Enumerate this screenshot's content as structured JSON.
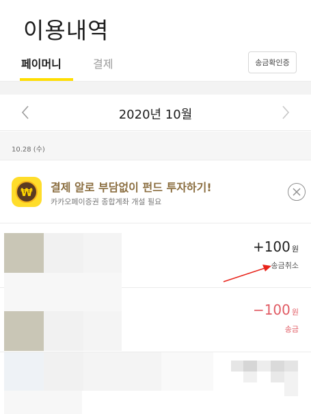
{
  "header": {
    "title": "이용내역",
    "tabs": [
      {
        "label": "페이머니",
        "selected": true
      },
      {
        "label": "결제",
        "selected": false
      }
    ],
    "verify_button": "송금확인증"
  },
  "month_selector": {
    "label": "2020년 10월",
    "prev_icon": "chevron-left-icon",
    "next_icon": "chevron-right-icon"
  },
  "date_header": "10.28 (수)",
  "promo": {
    "title": "결제 알로 부담없이 펀드 투자하기!",
    "subtitle": "카카오페이증권 종합계좌 개설 필요",
    "icon_symbol": "₩",
    "close_icon": "close-circle-icon"
  },
  "transactions": [
    {
      "amount": "+100",
      "unit": "원",
      "status": "송금취소",
      "color": "#1c1c1c",
      "status_color": "#555555"
    },
    {
      "amount": "−100",
      "unit": "원",
      "status": "송금",
      "color": "#e05a63",
      "status_color": "#e05a63"
    }
  ],
  "colors": {
    "accent": "#ffde00",
    "negative": "#e05a63",
    "promo_title": "#8a6d3f",
    "arrow": "#e8231a"
  }
}
